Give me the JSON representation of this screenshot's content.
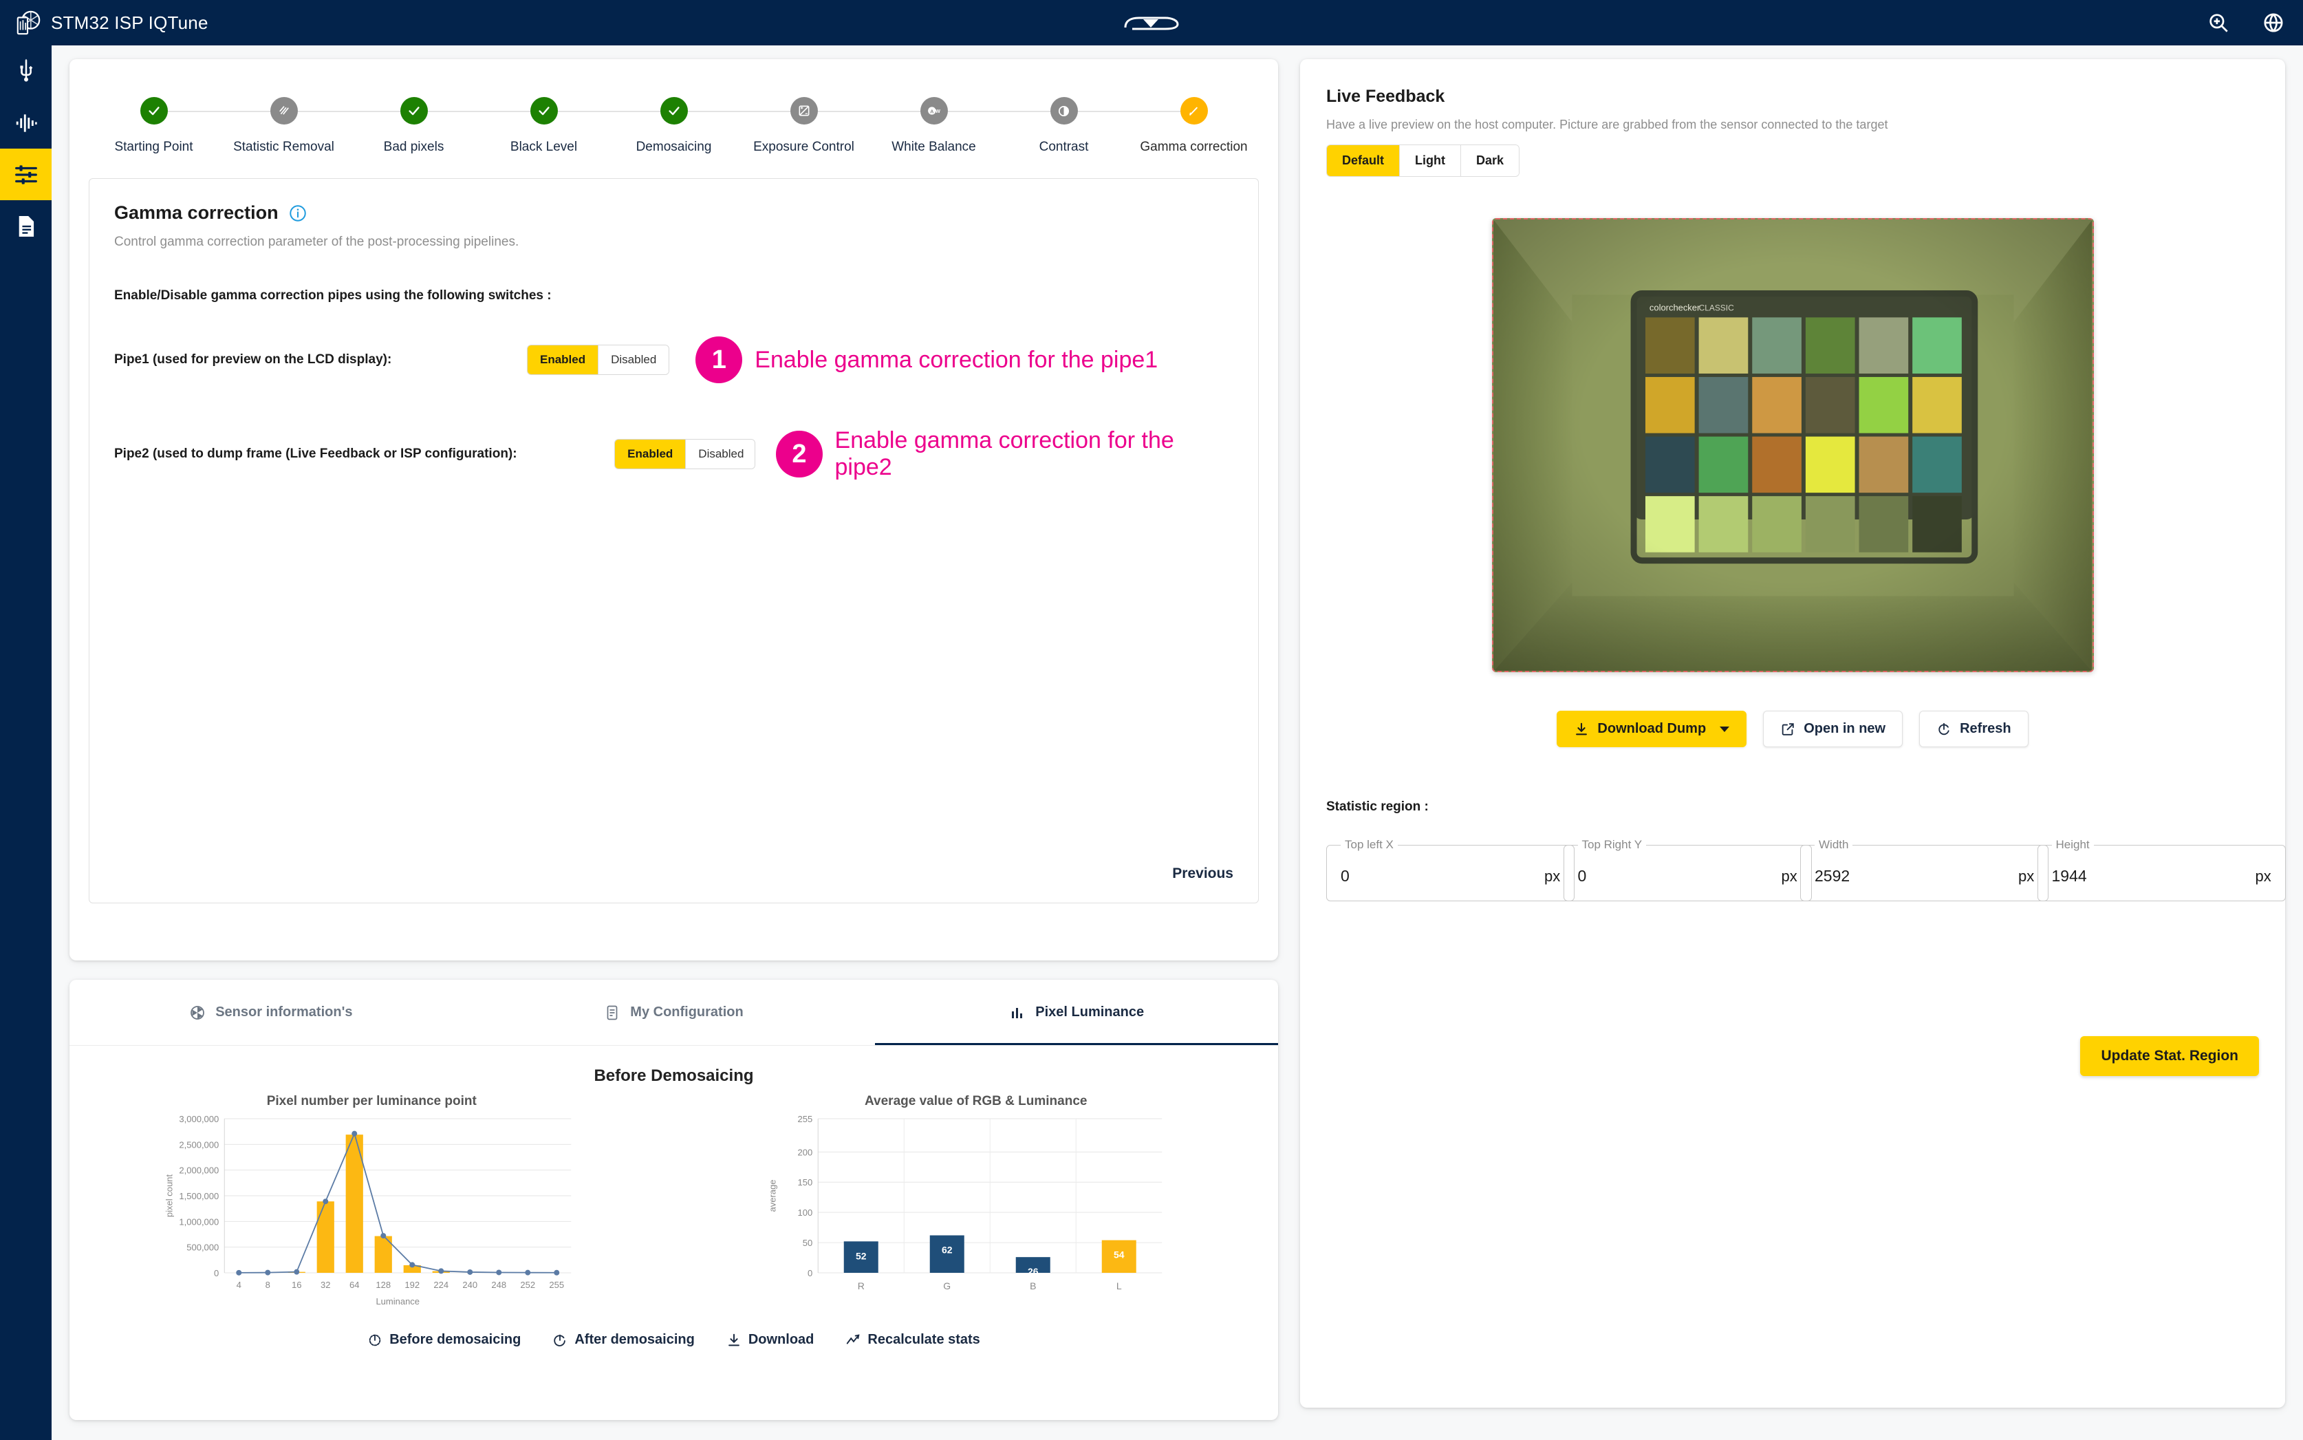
{
  "app": {
    "title": "STM32 ISP IQTune",
    "logo_icon": "aperture-chip-icon",
    "brand_mark": "st-logo"
  },
  "topbar": {
    "icons": [
      {
        "name": "zoom-in-icon",
        "label": "Zoom"
      },
      {
        "name": "globe-icon",
        "label": "Language"
      }
    ]
  },
  "sidebar": {
    "items": [
      {
        "icon": "usb-icon",
        "label": "Connection",
        "active": false
      },
      {
        "icon": "signal-waveform-icon",
        "label": "Signal",
        "active": false
      },
      {
        "icon": "tuning-sliders-icon",
        "label": "Tuning",
        "active": true
      },
      {
        "icon": "document-icon",
        "label": "Report",
        "active": false
      }
    ]
  },
  "stepper": {
    "steps": [
      {
        "label": "Starting Point",
        "state": "done",
        "icon": "check-icon"
      },
      {
        "label": "Statistic Removal",
        "state": "skip",
        "icon": "hatch-icon"
      },
      {
        "label": "Bad pixels",
        "state": "done",
        "icon": "check-icon"
      },
      {
        "label": "Black Level",
        "state": "done",
        "icon": "check-icon"
      },
      {
        "label": "Demosaicing",
        "state": "done",
        "icon": "check-icon"
      },
      {
        "label": "Exposure Control",
        "state": "pending",
        "icon": "exposure-icon"
      },
      {
        "label": "White Balance",
        "state": "pending",
        "icon": "awb-icon"
      },
      {
        "label": "Contrast",
        "state": "pending",
        "icon": "contrast-icon"
      },
      {
        "label": "Gamma correction",
        "state": "current",
        "icon": "pencil-icon"
      }
    ]
  },
  "panel": {
    "title": "Gamma correction",
    "info_icon": "info-icon",
    "subtitle": "Control gamma correction parameter of the post-processing pipelines.",
    "note": "Enable/Disable gamma correction pipes using the following switches :",
    "pipes": [
      {
        "label": "Pipe1 (used for preview on the LCD display):",
        "options": [
          "Enabled",
          "Disabled"
        ],
        "selected": "Enabled",
        "callout_number": "1",
        "callout_text": "Enable gamma correction for the pipe1"
      },
      {
        "label": "Pipe2 (used to dump frame (Live Feedback or ISP configuration):",
        "options": [
          "Enabled",
          "Disabled"
        ],
        "selected": "Enabled",
        "callout_number": "2",
        "callout_text": "Enable gamma correction for the pipe2"
      }
    ],
    "previous_label": "Previous"
  },
  "bottom": {
    "tabs": [
      {
        "label": "Sensor information's",
        "icon": "aperture-icon",
        "active": false
      },
      {
        "label": "My Configuration",
        "icon": "config-icon",
        "active": false
      },
      {
        "label": "Pixel Luminance",
        "icon": "bar-chart-icon",
        "active": true
      }
    ],
    "section_title": "Before Demosaicing",
    "actions": [
      {
        "label": "Before demosaicing",
        "icon": "rotate-ccw-icon"
      },
      {
        "label": "After demosaicing",
        "icon": "rotate-cw-icon"
      },
      {
        "label": "Download",
        "icon": "download-icon"
      },
      {
        "label": "Recalculate stats",
        "icon": "trending-icon"
      }
    ]
  },
  "chart_data": [
    {
      "type": "bar",
      "title": "Pixel number per luminance point",
      "xlabel": "Luminance",
      "ylabel": "pixel count",
      "categories": [
        "4",
        "8",
        "16",
        "32",
        "64",
        "128",
        "192",
        "224",
        "240",
        "248",
        "252",
        "255"
      ],
      "values": [
        2000,
        5000,
        18000,
        1390000,
        2690000,
        715000,
        148000,
        32000,
        12000,
        6000,
        4000,
        3000
      ],
      "line_values": [
        2000,
        5000,
        18000,
        1390000,
        2710000,
        722000,
        155000,
        35000,
        14000,
        7000,
        4500,
        3200
      ],
      "ylim": [
        0,
        3000000
      ],
      "yticks": [
        "0",
        "500,000",
        "1,000,000",
        "1,500,000",
        "2,000,000",
        "2,500,000",
        "3,000,000"
      ],
      "grid": true,
      "bar_color": "#fcb813",
      "line_color": "#5b7ba5",
      "legend": "none"
    },
    {
      "type": "bar",
      "title": "Average value of RGB & Luminance",
      "xlabel": "",
      "ylabel": "average",
      "categories": [
        "R",
        "G",
        "B",
        "L"
      ],
      "values": [
        52,
        62,
        26,
        54
      ],
      "data_labels": [
        "52",
        "62",
        "26",
        "54"
      ],
      "ylim": [
        0,
        255
      ],
      "yticks": [
        "0",
        "50",
        "100",
        "150",
        "200",
        "255"
      ],
      "grid": true,
      "colors": [
        "#1f4e79",
        "#1f4e79",
        "#1f4e79",
        "#fcb813"
      ],
      "legend": "none"
    }
  ],
  "live_feedback": {
    "title": "Live Feedback",
    "subtitle": "Have a live preview on the host computer. Picture are grabbed from the sensor connected to the target",
    "modes": [
      "Default",
      "Light",
      "Dark"
    ],
    "selected_mode": "Default",
    "preview_alt": "ColorChecker Classic chart inside a light box, green color cast",
    "preview_caption": "colorchecker CLASSIC",
    "buttons": [
      {
        "label": "Download Dump",
        "icon": "download-icon",
        "primary": true,
        "has_caret": true
      },
      {
        "label": "Open in new",
        "icon": "external-link-icon",
        "primary": false
      },
      {
        "label": "Refresh",
        "icon": "refresh-icon",
        "primary": false
      }
    ],
    "stat_region_label": "Statistic region :",
    "fields": [
      {
        "label": "Top left X",
        "value": "0",
        "unit": "px"
      },
      {
        "label": "Top Right Y",
        "value": "0",
        "unit": "px"
      },
      {
        "label": "Width",
        "value": "2592",
        "unit": "px"
      },
      {
        "label": "Height",
        "value": "1944",
        "unit": "px"
      }
    ],
    "update_button": "Update Stat. Region"
  },
  "colors": {
    "brand_navy": "#03234b",
    "accent_yellow": "#ffd200",
    "magenta": "#ec008c",
    "green": "#1d8102",
    "grey": "#8a8a8a"
  }
}
